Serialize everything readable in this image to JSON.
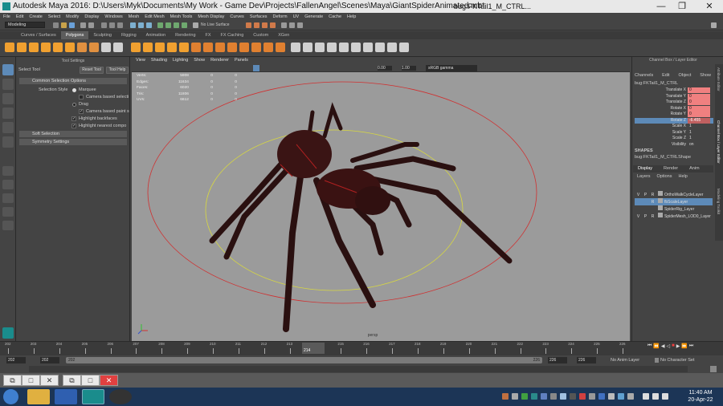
{
  "window": {
    "title": "Autodesk Maya 2016: D:\\Users\\Myk\\Documents\\My Work - Game Dev\\Projects\\FallenAngel\\Scenes\\Maya\\GiantSpiderAnimated.mb*",
    "object": "bug:FKTail1_M_CTRL...",
    "minimize": "—",
    "maximize": "❐",
    "close": "✕"
  },
  "menus": [
    "File",
    "Edit",
    "Create",
    "Select",
    "Modify",
    "Display",
    "Windows",
    "Mesh",
    "Edit Mesh",
    "Mesh Tools",
    "Mesh Display",
    "Curves",
    "Surfaces",
    "Deform",
    "UV",
    "Generate",
    "Cache",
    "Help"
  ],
  "status": {
    "mode": "Modeling",
    "live_surface": "No Live Surface"
  },
  "shelf_tabs": [
    "Curves / Surfaces",
    "Polygons",
    "Sculpting",
    "Rigging",
    "Animation",
    "Rendering",
    "FX",
    "FX Caching",
    "Custom",
    "XGen"
  ],
  "active_shelf": "Polygons",
  "tool_settings": {
    "header": "Tool Settings",
    "tool": "Select Tool",
    "reset": "Reset Tool",
    "help": "Tool Help",
    "sections": {
      "common": "Common Selection Options",
      "soft": "Soft Selection",
      "symmetry": "Symmetry Settings"
    },
    "selection_style_label": "Selection Style",
    "opt_marquee": "Marquee",
    "opt_camera_select": "Camera based selecti",
    "opt_drag": "Drag",
    "opt_camera_paint": "Camera based paint s",
    "opt_backfaces": "Highlight backfaces",
    "opt_nearest": "Highlight nearest compo"
  },
  "viewport": {
    "menus": [
      "View",
      "Shading",
      "Lighting",
      "Show",
      "Renderer",
      "Panels"
    ],
    "field1": "0.00",
    "field2": "1.00",
    "color_mgmt": "sRGB gamma",
    "camera": "persp",
    "hud": [
      {
        "label": "Verts:",
        "v1": "5908",
        "v2": "0",
        "v3": "0"
      },
      {
        "label": "Edges:",
        "v1": "11634",
        "v2": "0",
        "v3": "0"
      },
      {
        "label": "Faces:",
        "v1": "6020",
        "v2": "0",
        "v3": "0"
      },
      {
        "label": "Tris:",
        "v1": "11806",
        "v2": "0",
        "v3": "0"
      },
      {
        "label": "UVs:",
        "v1": "6612",
        "v2": "0",
        "v3": "0"
      }
    ]
  },
  "channel_box": {
    "title": "Channel Box / Layer Editor",
    "menus": [
      "Channels",
      "Edit",
      "Object",
      "Show"
    ],
    "object": "bug:FKTail1_M_CTRL",
    "attrs": [
      {
        "name": "Translate X",
        "value": "0"
      },
      {
        "name": "Translate Y",
        "value": "0"
      },
      {
        "name": "Translate Z",
        "value": "0"
      },
      {
        "name": "Rotate X",
        "value": "0"
      },
      {
        "name": "Rotate Y",
        "value": "0"
      },
      {
        "name": "Rotate Z",
        "value": "-6.455"
      },
      {
        "name": "Scale X",
        "value": "1"
      },
      {
        "name": "Scale Y",
        "value": "1"
      },
      {
        "name": "Scale Z",
        "value": "1"
      },
      {
        "name": "Visibility",
        "value": "on"
      }
    ],
    "shapes_label": "SHAPES",
    "shape": "bug:FKTail1_M_CTRLShape",
    "tabs": [
      "Display",
      "Render",
      "Anim"
    ],
    "layer_menus": [
      "Layers",
      "Options",
      "Help"
    ],
    "layers": [
      {
        "v": "V",
        "p": "P",
        "r": "R",
        "name": "OrthoWalkCycleLayer",
        "selected": false
      },
      {
        "v": "",
        "p": "",
        "r": "R",
        "name": "fbScaleLayer",
        "selected": true
      },
      {
        "v": "",
        "p": "",
        "r": "",
        "name": "SpiderRig_Layer",
        "selected": false
      },
      {
        "v": "V",
        "p": "P",
        "r": "R",
        "name": "SpiderMesh_LOD0_Layer",
        "selected": false
      }
    ],
    "side_tabs": [
      "Attribute Editor",
      "Channel Box / Layer Editor",
      "Modeling Toolkit"
    ]
  },
  "timeline": {
    "ticks": [
      "202",
      "203",
      "204",
      "205",
      "206",
      "207",
      "208",
      "209",
      "210",
      "211",
      "212",
      "213",
      "214",
      "215",
      "216",
      "217",
      "218",
      "219",
      "220",
      "221",
      "222",
      "223",
      "224",
      "225",
      "226"
    ],
    "current": "214",
    "range_start": "202",
    "range_inner_start": "202",
    "range_inner_end": "226",
    "range_end_a": "226",
    "range_end_b": "226",
    "anim_layer": "No Anim Layer",
    "character": "No Character Set"
  },
  "taskbar": {
    "time": "11:40 AM",
    "date": "20-Apr-22"
  }
}
